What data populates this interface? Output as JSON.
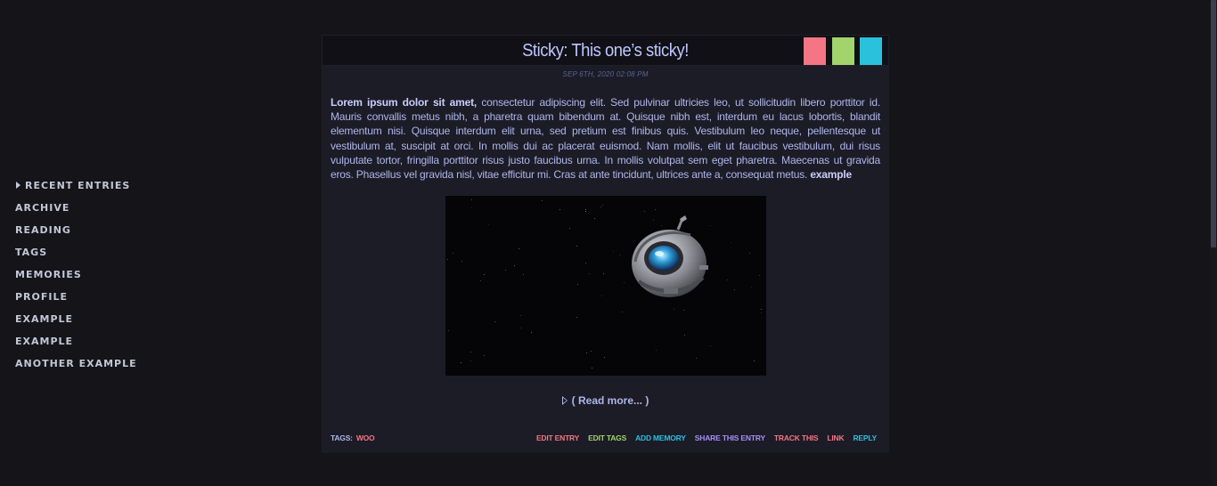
{
  "nav": {
    "items": [
      {
        "label": "Recent Entries",
        "active": true
      },
      {
        "label": "Archive"
      },
      {
        "label": "Reading"
      },
      {
        "label": "Tags"
      },
      {
        "label": "Memories"
      },
      {
        "label": "Profile"
      },
      {
        "label": "Example"
      },
      {
        "label": "Example"
      },
      {
        "label": "Another Example"
      }
    ]
  },
  "entry": {
    "title": "Sticky: This one’s sticky!",
    "date": "SEP 6TH, 2020 02:08 PM",
    "body_lead": "Lorem ipsum dolor sit amet,",
    "body_text": " consectetur adipiscing elit. Sed pulvinar ultricies leo, ut sollicitudin libero porttitor id. Mauris convallis metus nibh, a pharetra quam bibendum at. Quisque nibh est, interdum eu lacus lobortis, blandit elementum nisi. Quisque interdum elit urna, sed pretium est finibus quis. Vestibulum leo neque, pellentesque ut vestibulum at, suscipit at orci. In mollis dui ac placerat euismod. Nam mollis, elit ut faucibus vestibulum, dui risus vulputate tortor, fringilla porttitor risus justo faucibus urna. In mollis volutpat sem eget pharetra. Maecenas ut gravida eros. Phasellus vel gravida nisl, vitae efficitur mi. Cras at ante tincidunt, ultrices ante a, consequat metus. ",
    "body_link": "example",
    "image": "space-robot-orb",
    "read_more": "( Read more... )",
    "tags_label": "TAGS:",
    "tags": [
      "woo"
    ],
    "actions": [
      {
        "label": "Edit Entry",
        "color": "#f47583"
      },
      {
        "label": "Edit Tags",
        "color": "#a2d36c"
      },
      {
        "label": "Add Memory",
        "color": "#29c1dc"
      },
      {
        "label": "Share This Entry",
        "color": "#a98df2"
      },
      {
        "label": "Track This",
        "color": "#f47583"
      },
      {
        "label": "Link",
        "color": "#f47583"
      },
      {
        "label": "Reply",
        "color": "#29c1dc"
      }
    ],
    "swatches": [
      "#f47583",
      "#a2d36c",
      "#29c1dc"
    ]
  }
}
